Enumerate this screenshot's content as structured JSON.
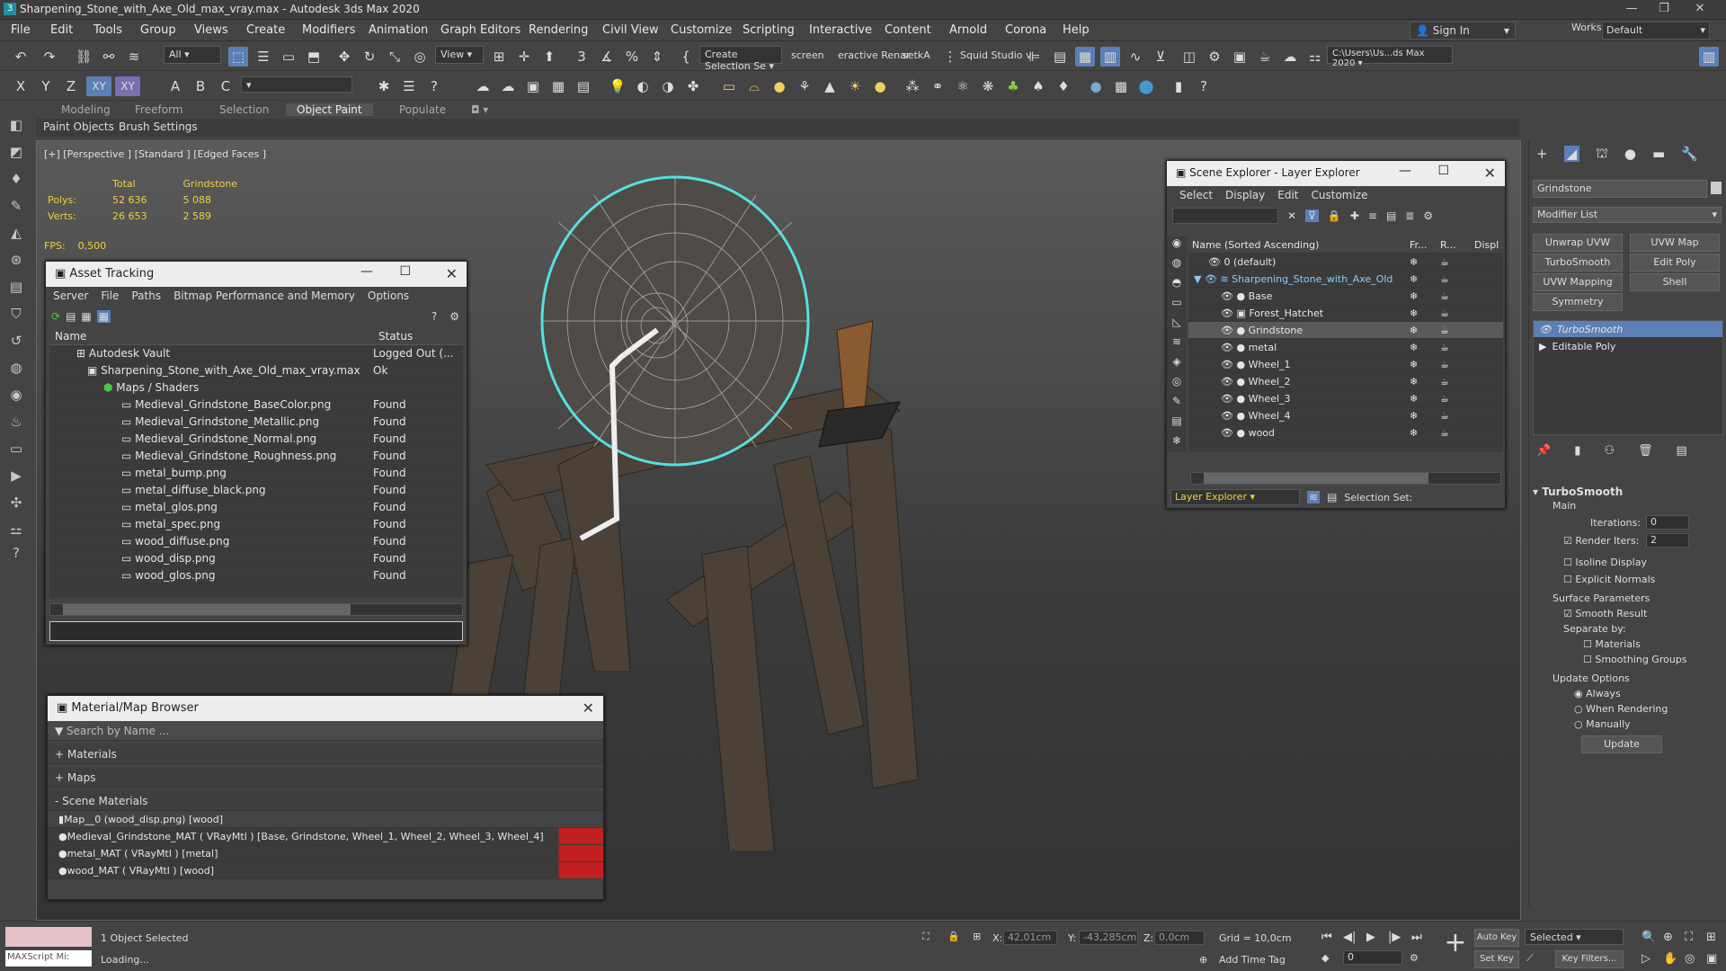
{
  "title": "Sharpening_Stone_with_Axe_Old_max_vray.max - Autodesk 3ds Max 2020",
  "menu": [
    "File",
    "Edit",
    "Tools",
    "Group",
    "Views",
    "Create",
    "Modifiers",
    "Animation",
    "Graph Editors",
    "Rendering",
    "Civil View",
    "Customize",
    "Scripting",
    "Interactive",
    "Content",
    "Arnold",
    "Corona",
    "Help"
  ],
  "signin": "Sign In",
  "workspaces_label": "Workspaces:",
  "workspace": "Default",
  "toolbar": {
    "filter": "All",
    "view": "View",
    "selset": "Create Selection Se",
    "screen": "screen",
    "interactive": "eractive Renar",
    "setka": "setkA",
    "squid": "Squid Studio v",
    "path": "C:\\Users\\Us...ds Max 2020"
  },
  "ribbon": {
    "tabs": [
      "Modeling",
      "Freeform",
      "Selection",
      "Object Paint",
      "Populate"
    ],
    "sub": [
      "Paint Objects",
      "Brush Settings"
    ]
  },
  "viewport": {
    "label": "[+] [Perspective ] [Standard ] [Edged Faces ]",
    "total": "Total",
    "obj": "Grindstone",
    "polys_l": "Polys:",
    "polys_t": "52 636",
    "polys_o": "5 088",
    "verts_l": "Verts:",
    "verts_t": "26 653",
    "verts_o": "2 589",
    "fps_l": "FPS:",
    "fps": "0,500"
  },
  "asset": {
    "title": "Asset Tracking",
    "menu": [
      "Server",
      "File",
      "Paths",
      "Bitmap Performance and Memory",
      "Options"
    ],
    "col_name": "Name",
    "col_status": "Status",
    "rows": [
      {
        "n": "Autodesk Vault",
        "s": "Logged Out (..."
      },
      {
        "n": "Sharpening_Stone_with_Axe_Old_max_vray.max",
        "s": "Ok"
      },
      {
        "n": "Maps / Shaders",
        "s": ""
      },
      {
        "n": "Medieval_Grindstone_BaseColor.png",
        "s": "Found"
      },
      {
        "n": "Medieval_Grindstone_Metallic.png",
        "s": "Found"
      },
      {
        "n": "Medieval_Grindstone_Normal.png",
        "s": "Found"
      },
      {
        "n": "Medieval_Grindstone_Roughness.png",
        "s": "Found"
      },
      {
        "n": "metal_bump.png",
        "s": "Found"
      },
      {
        "n": "metal_diffuse_black.png",
        "s": "Found"
      },
      {
        "n": "metal_glos.png",
        "s": "Found"
      },
      {
        "n": "metal_spec.png",
        "s": "Found"
      },
      {
        "n": "wood_diffuse.png",
        "s": "Found"
      },
      {
        "n": "wood_disp.png",
        "s": "Found"
      },
      {
        "n": "wood_glos.png",
        "s": "Found"
      }
    ]
  },
  "matbrowser": {
    "title": "Material/Map Browser",
    "search": "Search by Name ...",
    "materials": "+ Materials",
    "maps": "+ Maps",
    "scene": "- Scene Materials",
    "items": [
      "Map__0 (wood_disp.png) [wood]",
      "Medieval_Grindstone_MAT  ( VRayMtl )  [Base, Grindstone, Wheel_1, Wheel_2, Wheel_3, Wheel_4]",
      "metal_MAT  ( VRayMtl )  [metal]",
      "wood_MAT  ( VRayMtl )  [wood]"
    ]
  },
  "scene": {
    "title": "Scene Explorer - Layer Explorer",
    "menu": [
      "Select",
      "Display",
      "Edit",
      "Customize"
    ],
    "col_name": "Name (Sorted Ascending)",
    "col_fr": "Fr...",
    "col_r": "R...",
    "col_d": "Displ",
    "rows": [
      "0 (default)",
      "Sharpening_Stone_with_Axe_Old",
      "Base",
      "Forest_Hatchet",
      "Grindstone",
      "metal",
      "Wheel_1",
      "Wheel_2",
      "Wheel_3",
      "Wheel_4",
      "wood"
    ],
    "footer": "Layer Explorer",
    "selset": "Selection Set:"
  },
  "cmd": {
    "obj": "Grindstone",
    "modlist": "Modifier List",
    "btns": [
      "Unwrap UVW",
      "UVW Map",
      "TurboSmooth",
      "Edit Poly",
      "UVW Mapping Clear",
      "Shell",
      "Symmetry"
    ],
    "stack": [
      "TurboSmooth",
      "Editable Poly"
    ],
    "ts": {
      "title": "TurboSmooth",
      "main": "Main",
      "iter_l": "Iterations:",
      "iter": "0",
      "rend_l": "Render Iters:",
      "rend": "2",
      "isoline": "Isoline Display",
      "explicit": "Explicit Normals",
      "surface": "Surface Parameters",
      "smooth": "Smooth Result",
      "sepby": "Separate by:",
      "mats": "Materials",
      "sg": "Smoothing Groups",
      "update": "Update Options",
      "always": "Always",
      "whenr": "When Rendering",
      "manual": "Manually",
      "upd_btn": "Update"
    }
  },
  "status": {
    "maxscript": "MAXScript Mi:",
    "selected": "1 Object Selected",
    "loading": "Loading...",
    "x_l": "X:",
    "x": "42,01cm",
    "y_l": "Y:",
    "y": "-43,285cm",
    "z_l": "Z:",
    "z": "0,0cm",
    "grid": "Grid = 10,0cm",
    "addtime": "Add Time Tag",
    "autokey": "Auto Key",
    "setkey": "Set Key",
    "selmode": "Selected",
    "keyfilters": "Key Filters...",
    "frame": "0"
  }
}
